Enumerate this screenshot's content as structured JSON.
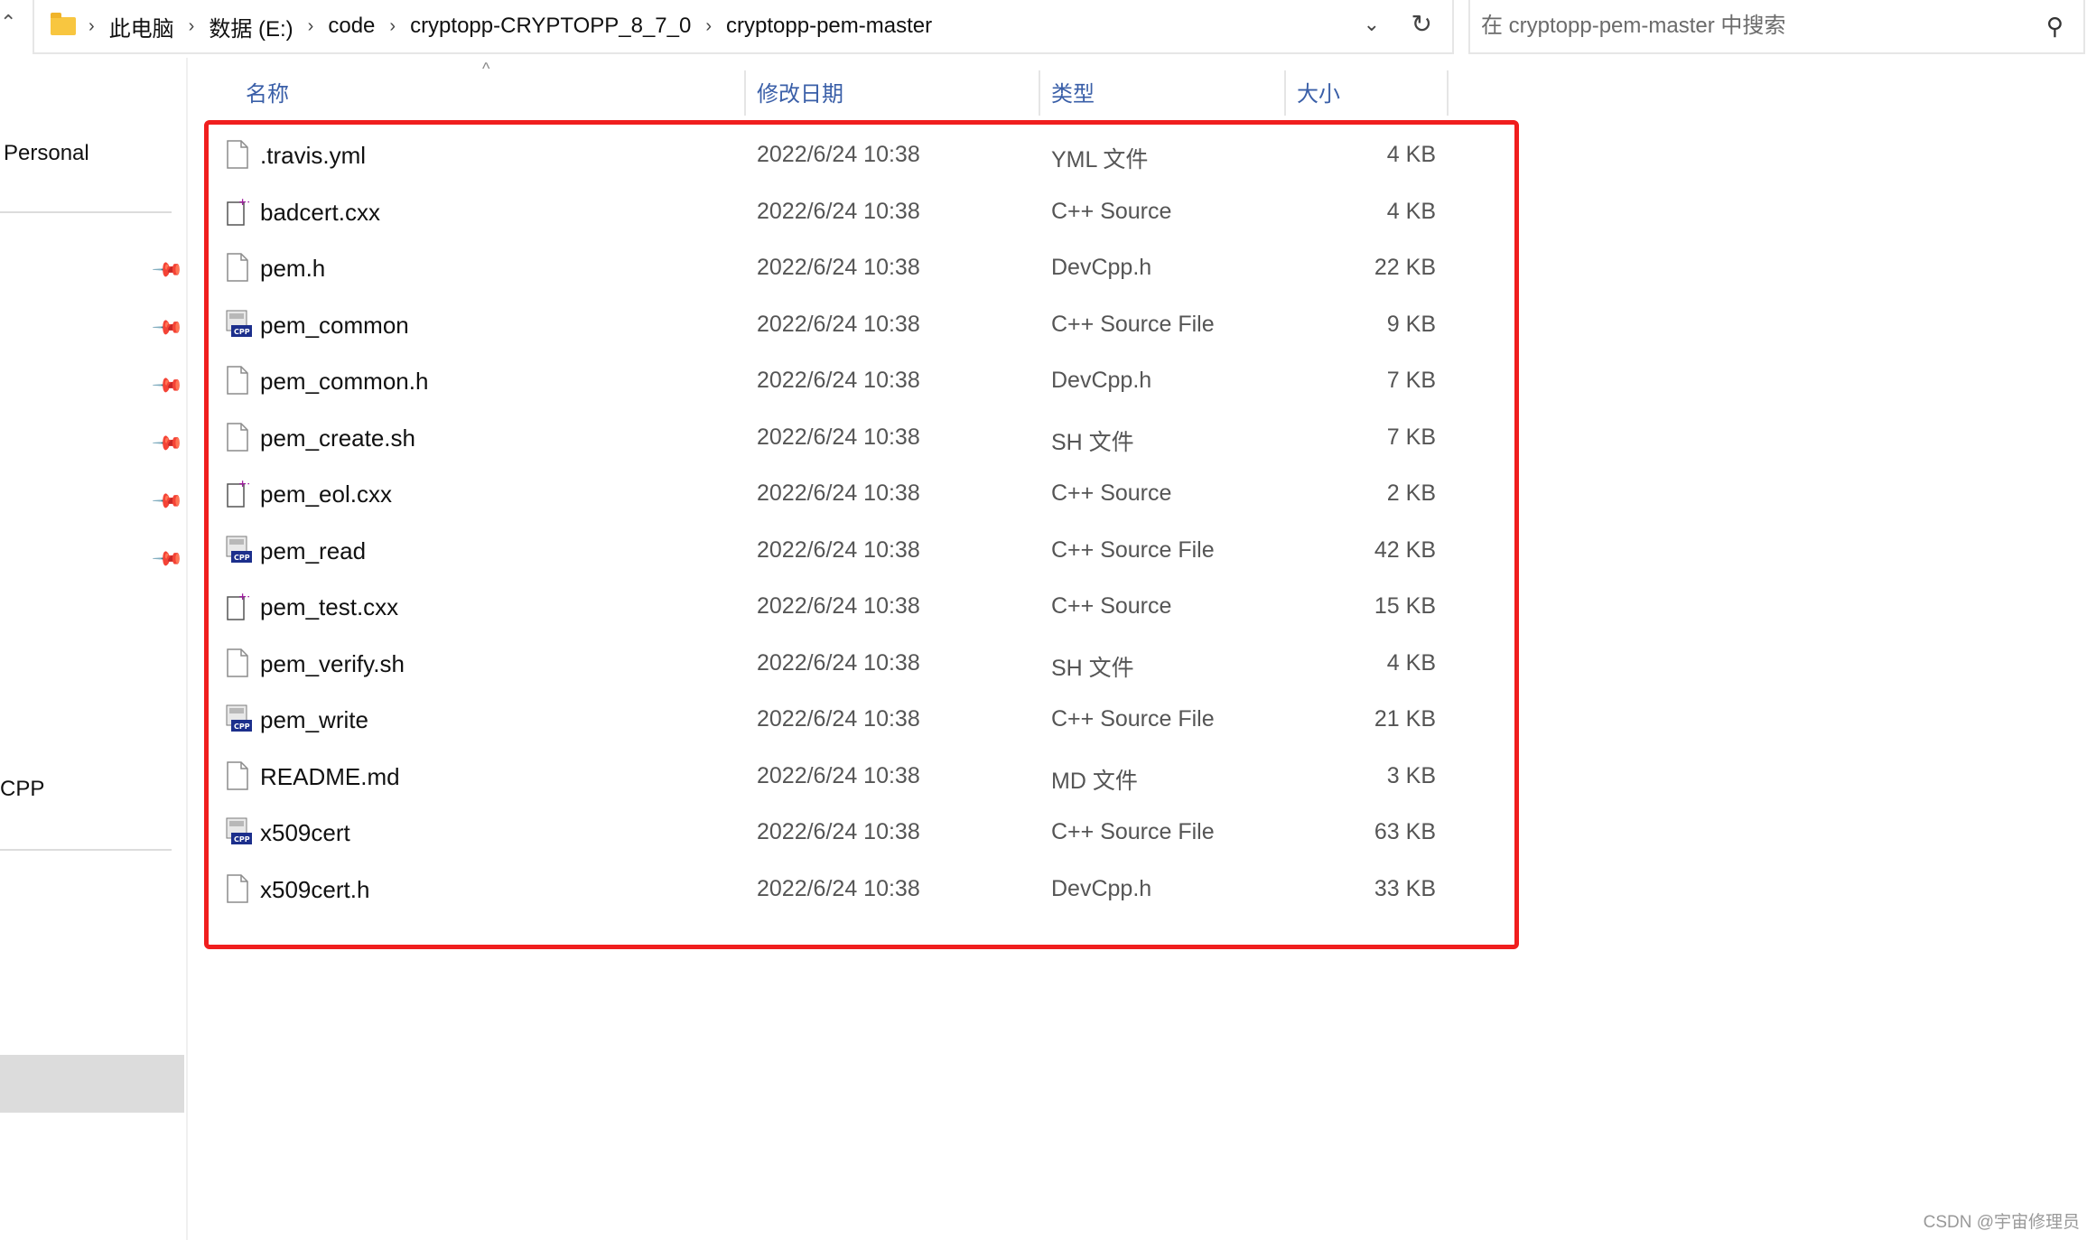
{
  "breadcrumb": [
    "此电脑",
    "数据 (E:)",
    "code",
    "cryptopp-CRYPTOPP_8_7_0",
    "cryptopp-pem-master"
  ],
  "search": {
    "placeholder": "在 cryptopp-pem-master 中搜索"
  },
  "sidebar": {
    "personal_label": "Personal",
    "cpp_label": "CPP"
  },
  "columns": {
    "name": "名称",
    "date": "修改日期",
    "type": "类型",
    "size": "大小"
  },
  "files": [
    {
      "name": ".travis.yml",
      "date": "2022/6/24 10:38",
      "type": "YML 文件",
      "size": "4 KB",
      "icon": "blank-file-icon"
    },
    {
      "name": "badcert.cxx",
      "date": "2022/6/24 10:38",
      "type": "C++ Source",
      "size": "4 KB",
      "icon": "cpp-plus-file-icon"
    },
    {
      "name": "pem.h",
      "date": "2022/6/24 10:38",
      "type": "DevCpp.h",
      "size": "22 KB",
      "icon": "blank-file-icon"
    },
    {
      "name": "pem_common",
      "date": "2022/6/24 10:38",
      "type": "C++ Source File",
      "size": "9 KB",
      "icon": "devcpp-cpp-icon"
    },
    {
      "name": "pem_common.h",
      "date": "2022/6/24 10:38",
      "type": "DevCpp.h",
      "size": "7 KB",
      "icon": "blank-file-icon"
    },
    {
      "name": "pem_create.sh",
      "date": "2022/6/24 10:38",
      "type": "SH 文件",
      "size": "7 KB",
      "icon": "blank-file-icon"
    },
    {
      "name": "pem_eol.cxx",
      "date": "2022/6/24 10:38",
      "type": "C++ Source",
      "size": "2 KB",
      "icon": "cpp-plus-file-icon"
    },
    {
      "name": "pem_read",
      "date": "2022/6/24 10:38",
      "type": "C++ Source File",
      "size": "42 KB",
      "icon": "devcpp-cpp-icon"
    },
    {
      "name": "pem_test.cxx",
      "date": "2022/6/24 10:38",
      "type": "C++ Source",
      "size": "15 KB",
      "icon": "cpp-plus-file-icon"
    },
    {
      "name": "pem_verify.sh",
      "date": "2022/6/24 10:38",
      "type": "SH 文件",
      "size": "4 KB",
      "icon": "blank-file-icon"
    },
    {
      "name": "pem_write",
      "date": "2022/6/24 10:38",
      "type": "C++ Source File",
      "size": "21 KB",
      "icon": "devcpp-cpp-icon"
    },
    {
      "name": "README.md",
      "date": "2022/6/24 10:38",
      "type": "MD 文件",
      "size": "3 KB",
      "icon": "blank-file-icon"
    },
    {
      "name": "x509cert",
      "date": "2022/6/24 10:38",
      "type": "C++ Source File",
      "size": "63 KB",
      "icon": "devcpp-cpp-icon"
    },
    {
      "name": "x509cert.h",
      "date": "2022/6/24 10:38",
      "type": "DevCpp.h",
      "size": "33 KB",
      "icon": "blank-file-icon"
    }
  ],
  "watermark": "CSDN @宇宙修理员",
  "colors": {
    "highlight": "#f01e1e",
    "header_text": "#3a5fa8",
    "folder": "#f8c640"
  }
}
